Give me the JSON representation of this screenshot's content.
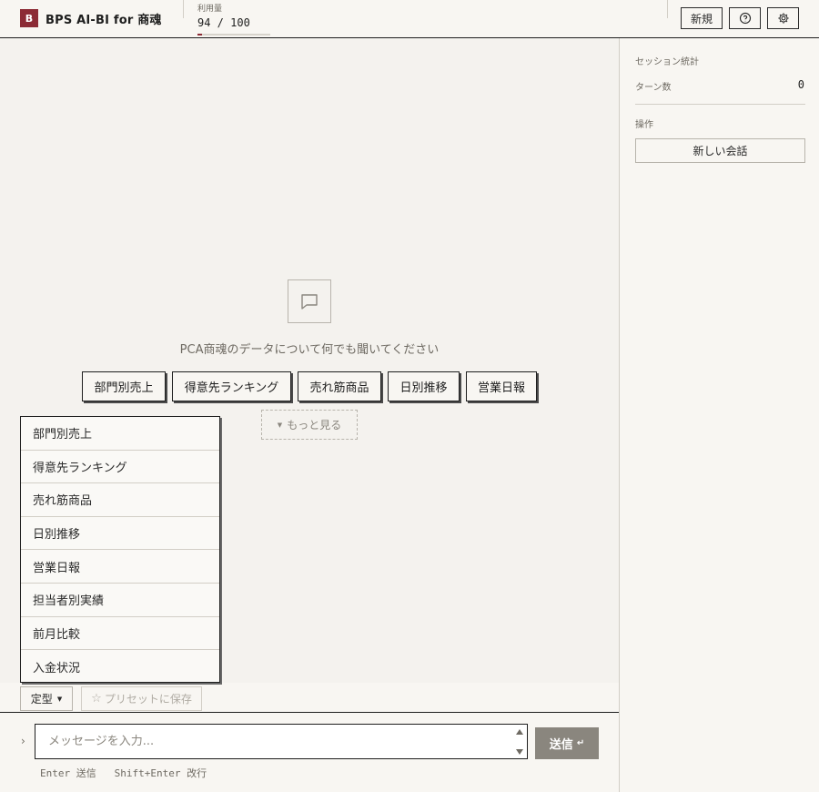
{
  "header": {
    "logo_letter": "B",
    "title": "BPS AI-BI for 商魂",
    "usage_label": "利用量",
    "usage_value": "94 / 100",
    "usage_fraction": 0.06,
    "new_button": "新規",
    "help_icon": "help-icon",
    "settings_icon": "gear-icon"
  },
  "main": {
    "empty_icon": "chat-bubble-icon",
    "empty_text": "PCA商魂のデータについて何でも聞いてください",
    "chips": [
      "部門別売上",
      "得意先ランキング",
      "売れ筋商品",
      "日別推移",
      "営業日報"
    ],
    "more_label": "もっと見る"
  },
  "dropdown": {
    "items": [
      "部門別売上",
      "得意先ランキング",
      "売れ筋商品",
      "日別推移",
      "営業日報",
      "担当者別実績",
      "前月比較",
      "入金状況"
    ]
  },
  "toolbar": {
    "teikei_label": "定型",
    "preset_label": "プリセットに保存"
  },
  "input": {
    "prompt": "›",
    "placeholder": "メッセージを入力...",
    "send_label": "送信",
    "hint": "Enter 送信   Shift+Enter 改行"
  },
  "side": {
    "stats_title": "セッション統計",
    "turns_label": "ターン数",
    "turns_value": "0",
    "ops_title": "操作",
    "new_conversation": "新しい会話"
  },
  "colors": {
    "brand": "#8c2b35",
    "send_disabled": "#8a867e"
  }
}
